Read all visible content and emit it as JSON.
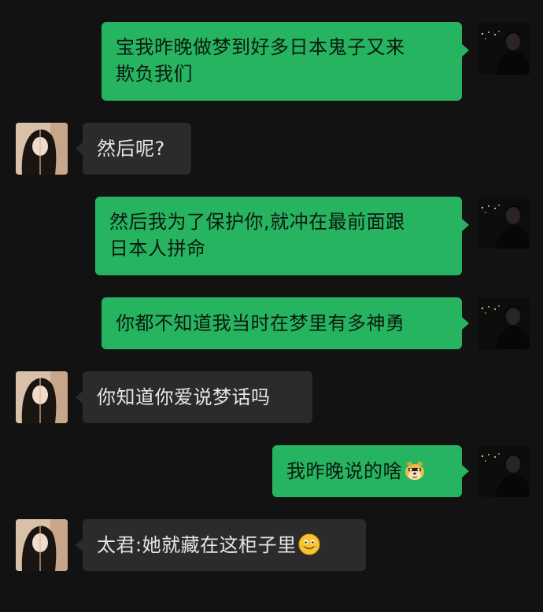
{
  "messages": [
    {
      "side": "right",
      "text": "宝我昨晚做梦到好多日本鬼子又来欺负我们",
      "line1": "宝我昨晚做梦到好多日本鬼子又来",
      "line2": "欺负我们"
    },
    {
      "side": "left",
      "text": "然后呢?"
    },
    {
      "side": "right",
      "line1": "然后我为了保护你,就冲在最前面跟",
      "line2": "日本人拼命"
    },
    {
      "side": "right",
      "text": "你都不知道我当时在梦里有多神勇"
    },
    {
      "side": "left",
      "text": "你知道你爱说梦话吗"
    },
    {
      "side": "right",
      "text": "我昨晚说的啥",
      "emoji": "doge-emoji"
    },
    {
      "side": "left",
      "text": "太君:她就藏在这柜子里",
      "emoji": "smile-emoji"
    }
  ],
  "colors": {
    "background": "#121212",
    "sent_bubble": "#27b461",
    "received_bubble": "#2b2b2b",
    "sent_text": "#0b1a0f",
    "received_text": "#e6e6e6"
  },
  "icons": {
    "self_avatar": "avatar-self",
    "other_avatar": "avatar-other"
  }
}
